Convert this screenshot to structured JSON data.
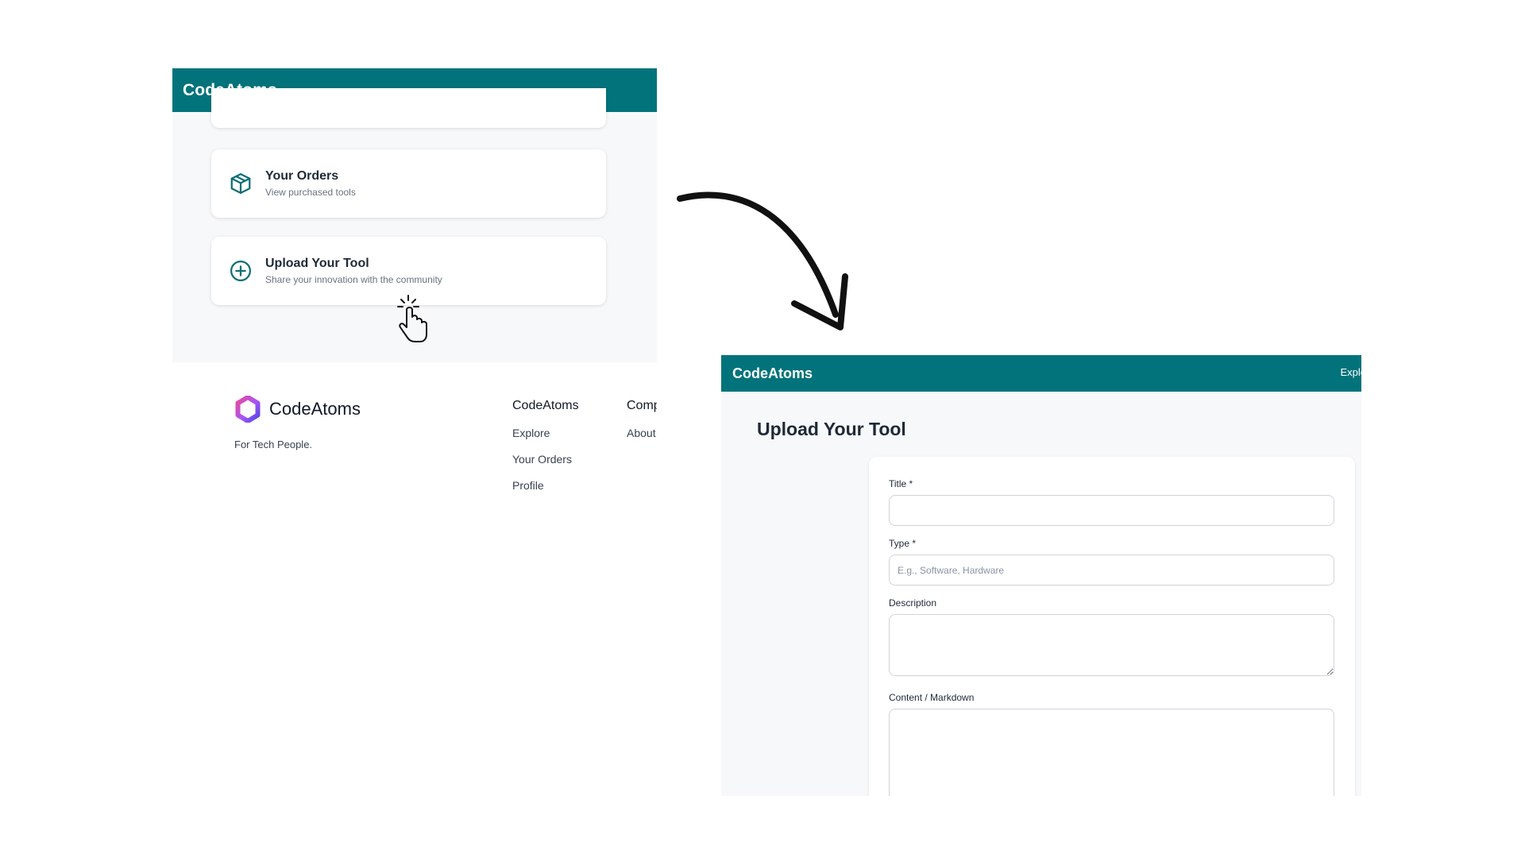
{
  "left_screen": {
    "app_title": "CodeAtoms",
    "menu": [
      {
        "title": "Your Orders",
        "subtitle": "View purchased tools",
        "icon": "package-icon"
      },
      {
        "title": "Upload Your Tool",
        "subtitle": "Share your innovation with the community",
        "icon": "plus-circle-icon"
      }
    ],
    "footer": {
      "brand": "CodeAtoms",
      "tagline": "For Tech People.",
      "col1": {
        "heading": "CodeAtoms",
        "links": [
          "Explore",
          "Your Orders",
          "Profile"
        ]
      },
      "col2": {
        "heading": "Comp",
        "links": [
          "About"
        ]
      }
    }
  },
  "right_screen": {
    "app_title": "CodeAtoms",
    "nav_link": "Explo",
    "page_title": "Upload Your Tool",
    "form": {
      "title_label": "Title *",
      "title_value": "",
      "type_label": "Type *",
      "type_placeholder": "E.g., Software, Hardware",
      "description_label": "Description",
      "content_label": "Content / Markdown"
    }
  },
  "colors": {
    "header_teal": "#02737a",
    "page_bg": "#f7f8fa",
    "card_bg": "#ffffff"
  }
}
